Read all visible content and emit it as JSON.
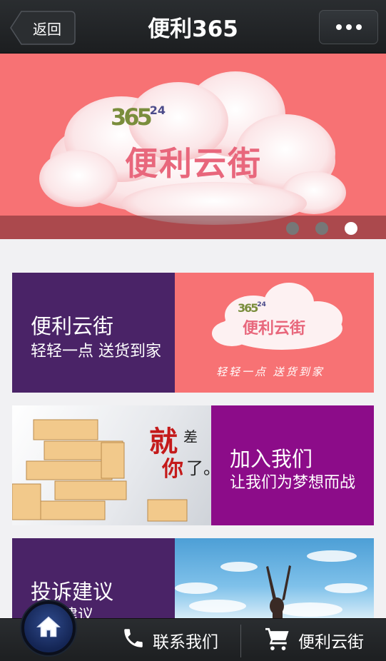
{
  "navbar": {
    "back_label": "返回",
    "title": "便利365"
  },
  "banner": {
    "logo_number": "365",
    "logo_small": "24",
    "logo_text": "便利云街",
    "dots": 3,
    "active_dot": 2
  },
  "cards": [
    {
      "title": "便利云街",
      "subtitle": "轻轻一点 送货到家",
      "image_logo_number": "365",
      "image_logo_small": "24",
      "image_logo_text": "便利云街",
      "image_slogan": "轻轻一点 送货到家"
    },
    {
      "title": "加入我们",
      "subtitle": "让我们为梦想而战",
      "image_text_1": "就",
      "image_text_2": "差",
      "image_text_3": "你",
      "image_text_4": "了。"
    },
    {
      "title": "投诉建议",
      "subtitle": "建议"
    }
  ],
  "tabbar": {
    "contact_label": "联系我们",
    "shop_label": "便利云街"
  },
  "icons": {
    "home": "home-icon",
    "phone": "phone-icon",
    "cart": "cart-icon",
    "more": "more-dots-icon"
  },
  "colors": {
    "banner_red": "#f77274",
    "card_purple_dark": "#4a2367",
    "card_purple_magenta": "#8c0c89",
    "navbar": "#222528"
  }
}
